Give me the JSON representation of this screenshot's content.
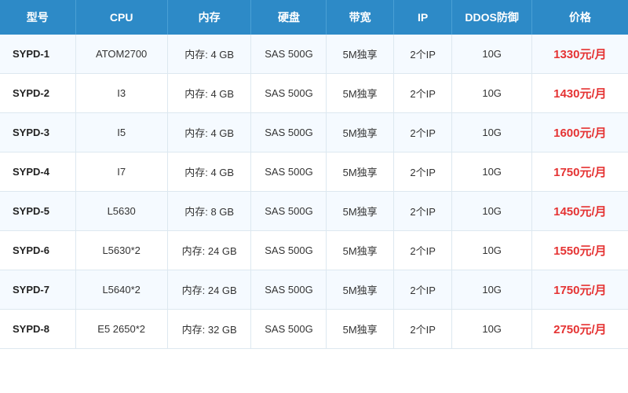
{
  "table": {
    "headers": [
      "型号",
      "CPU",
      "内存",
      "硬盘",
      "带宽",
      "IP",
      "DDOS防御",
      "价格"
    ],
    "rows": [
      {
        "model": "SYPD-1",
        "cpu": "ATOM2700",
        "mem": "内存: 4 GB",
        "disk": "SAS 500G",
        "bw": "5M独享",
        "ip": "2个IP",
        "ddos": "10G",
        "price": "1330元/月"
      },
      {
        "model": "SYPD-2",
        "cpu": "I3",
        "mem": "内存: 4 GB",
        "disk": "SAS 500G",
        "bw": "5M独享",
        "ip": "2个IP",
        "ddos": "10G",
        "price": "1430元/月"
      },
      {
        "model": "SYPD-3",
        "cpu": "I5",
        "mem": "内存: 4 GB",
        "disk": "SAS 500G",
        "bw": "5M独享",
        "ip": "2个IP",
        "ddos": "10G",
        "price": "1600元/月"
      },
      {
        "model": "SYPD-4",
        "cpu": "I7",
        "mem": "内存: 4 GB",
        "disk": "SAS 500G",
        "bw": "5M独享",
        "ip": "2个IP",
        "ddos": "10G",
        "price": "1750元/月"
      },
      {
        "model": "SYPD-5",
        "cpu": "L5630",
        "mem": "内存: 8 GB",
        "disk": "SAS 500G",
        "bw": "5M独享",
        "ip": "2个IP",
        "ddos": "10G",
        "price": "1450元/月"
      },
      {
        "model": "SYPD-6",
        "cpu": "L5630*2",
        "mem": "内存: 24 GB",
        "disk": "SAS 500G",
        "bw": "5M独享",
        "ip": "2个IP",
        "ddos": "10G",
        "price": "1550元/月"
      },
      {
        "model": "SYPD-7",
        "cpu": "L5640*2",
        "mem": "内存: 24 GB",
        "disk": "SAS 500G",
        "bw": "5M独享",
        "ip": "2个IP",
        "ddos": "10G",
        "price": "1750元/月"
      },
      {
        "model": "SYPD-8",
        "cpu": "E5 2650*2",
        "mem": "内存: 32 GB",
        "disk": "SAS 500G",
        "bw": "5M独享",
        "ip": "2个IP",
        "ddos": "10G",
        "price": "2750元/月"
      }
    ]
  }
}
